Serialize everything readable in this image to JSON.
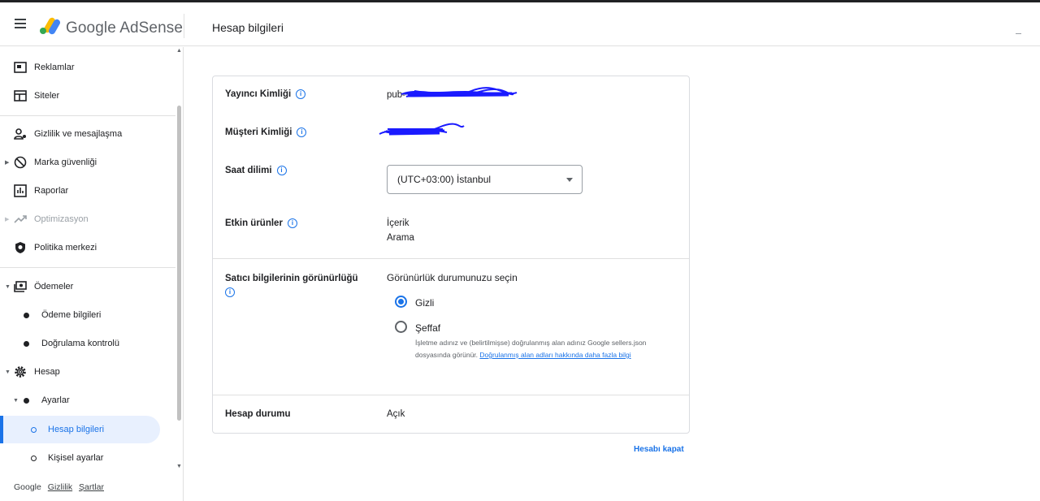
{
  "header": {
    "brand": "Google AdSense",
    "page_title": "Hesap bilgileri"
  },
  "sidebar": {
    "items": [
      {
        "label": "Reklamlar",
        "icon": "ads-icon"
      },
      {
        "label": "Siteler",
        "icon": "sites-icon"
      },
      {
        "label": "Gizlilik ve mesajlaşma",
        "icon": "privacy-icon"
      },
      {
        "label": "Marka güvenliği",
        "icon": "block-icon"
      },
      {
        "label": "Raporlar",
        "icon": "reports-icon"
      },
      {
        "label": "Optimizasyon",
        "icon": "trending-icon"
      },
      {
        "label": "Politika merkezi",
        "icon": "policy-shield-icon"
      },
      {
        "label": "Ödemeler",
        "icon": "payments-icon"
      },
      {
        "label": "Ödeme bilgileri"
      },
      {
        "label": "Doğrulama kontrolü"
      },
      {
        "label": "Hesap",
        "icon": "gear-icon"
      },
      {
        "label": "Ayarlar"
      },
      {
        "label": "Hesap bilgileri"
      },
      {
        "label": "Kişisel ayarlar"
      }
    ],
    "footer": {
      "google": "Google",
      "privacy": "Gizlilik",
      "terms": "Şartlar"
    }
  },
  "account": {
    "publisher_id_label": "Yayıncı Kimliği",
    "publisher_id_value": "pub-",
    "customer_id_label": "Müşteri Kimliği",
    "timezone_label": "Saat dilimi",
    "timezone_value": "(UTC+03:00) İstanbul",
    "active_products_label": "Etkin ürünler",
    "active_products": [
      "İçerik",
      "Arama"
    ],
    "seller_visibility_label": "Satıcı bilgilerinin görünürlüğü",
    "visibility_prompt": "Görünürlük durumunuzu seçin",
    "option_hidden": "Gizli",
    "option_transparent": "Şeffaf",
    "transparent_help": "İşletme adınız ve (belirtilmişse) doğrulanmış alan adınız Google sellers.json dosyasında görünür.",
    "transparent_help_link": "Doğrulanmış alan adları hakkında daha fazla bilgi",
    "status_label": "Hesap durumu",
    "status_value": "Açık",
    "close_account": "Hesabı kapat"
  },
  "colors": {
    "accent": "#1a73e8",
    "active_bg": "#e8f0fe",
    "redaction": "#1a1aff"
  }
}
